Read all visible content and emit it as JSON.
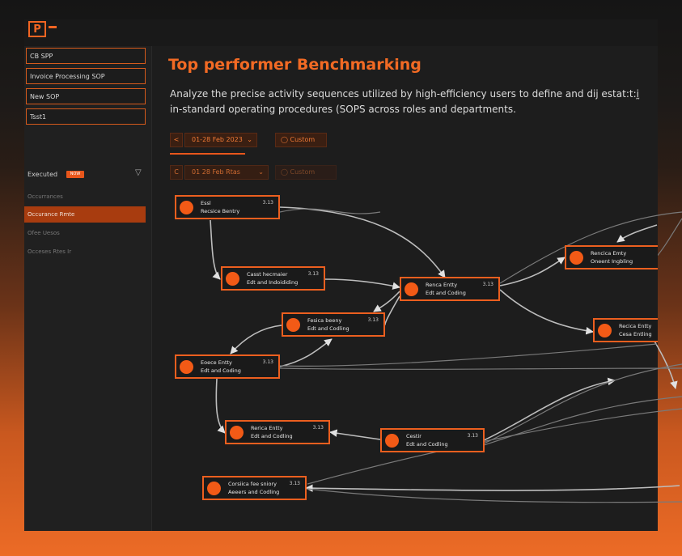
{
  "app": {
    "logo": "P"
  },
  "sidebar": {
    "sops": [
      "CB SPP",
      "Invoice Processing SOP",
      "New SOP",
      "Tsst1"
    ],
    "section_label": "Executed",
    "badge": "NOW",
    "options": [
      "Occurrances",
      "Occurance Rmte",
      "Ofee Uesos",
      "Occeses Rtes Ir"
    ]
  },
  "main": {
    "title": "Top performer Benchmarking",
    "description": "Analyze the precise activity sequences utilized by high-efficiency users to define and dĳ estat:t:ḭ in-standard operating procedures (SOPS across roles and departments.",
    "filter1": {
      "prev": "<",
      "range": "01-28 Feb 2023",
      "custom": "Custom"
    },
    "filter2": {
      "prev": "C",
      "range": "01 28 Feb Rtas",
      "custom": "Custom"
    }
  },
  "nodes": [
    {
      "l1": "Essl",
      "l2": "Recsice Bentry",
      "num": "3.13"
    },
    {
      "l1": "Casst hecmaier",
      "l2": "Edt and Indoididing",
      "num": "3.13"
    },
    {
      "l1": "Renca Entty",
      "l2": "Edt and Coding",
      "num": "3.13"
    },
    {
      "l1": "Rencica Emty",
      "l2": "Oneent Ingbling",
      "num": ""
    },
    {
      "l1": "Fesica beeny",
      "l2": "Edt and Codling",
      "num": "3.13"
    },
    {
      "l1": "Recica Entty",
      "l2": "Cesa Entling",
      "num": ""
    },
    {
      "l1": "Eoece Entty",
      "l2": "Edt and Coding",
      "num": "3.13"
    },
    {
      "l1": "Rerica Entty",
      "l2": "Edt and Codling",
      "num": "3.13"
    },
    {
      "l1": "Cestir",
      "l2": "Edt and Codling",
      "num": "3.13"
    },
    {
      "l1": "Corsiica fee sniory",
      "l2": "Aeeers and Codling",
      "num": "3.13"
    }
  ],
  "colors": {
    "accent": "#f26522",
    "node_border": "#ec5f1f",
    "background": "#191919"
  }
}
